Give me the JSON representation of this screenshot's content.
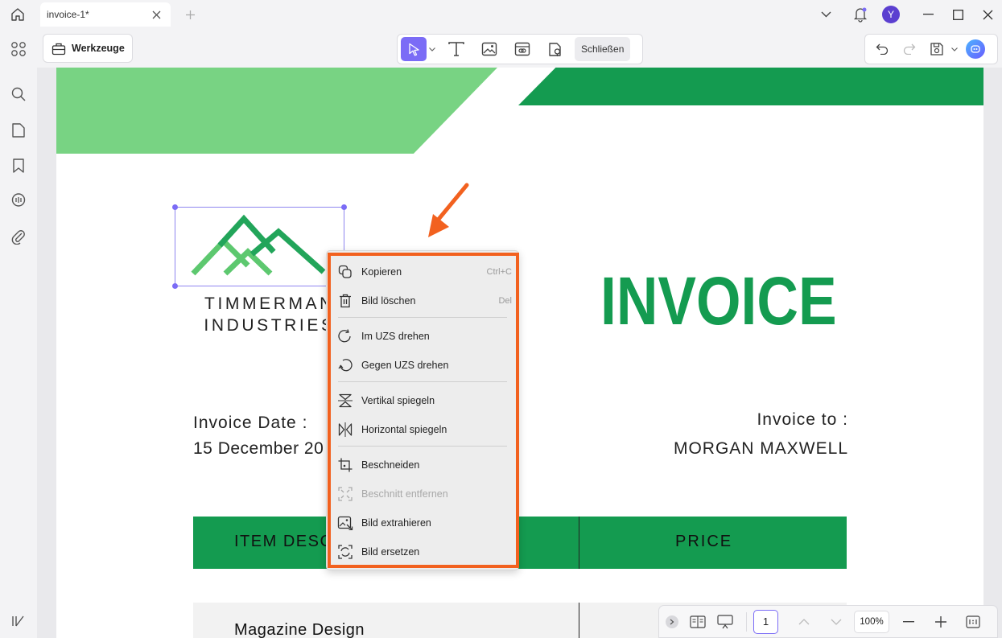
{
  "tab": {
    "title": "invoice-1*"
  },
  "toolbar": {
    "werkzeuge_label": "Werkzeuge",
    "close_label": "Schließen"
  },
  "user": {
    "avatar_letter": "Y"
  },
  "document": {
    "company_line1": "TIMMERMAN",
    "company_line2": "INDUSTRIES",
    "title": "INVOICE",
    "invoice_date_label": "Invoice Date :",
    "invoice_date_value": "15 December 20",
    "invoice_to_label": "Invoice to :",
    "invoice_to_value": "MORGAN MAXWELL",
    "table_header_desc": "ITEM DESC",
    "table_header_price": "PRICE",
    "row1_desc": "Magazine Design",
    "colors": {
      "light_green": "#78d383",
      "dark_green": "#149b50"
    }
  },
  "context_menu": {
    "items": [
      {
        "label": "Kopieren",
        "shortcut": "Ctrl+C",
        "icon": "copy-icon"
      },
      {
        "label": "Bild löschen",
        "shortcut": "Del",
        "icon": "trash-icon"
      },
      {
        "label": "Im UZS drehen",
        "shortcut": "",
        "icon": "rotate-cw-icon"
      },
      {
        "label": "Gegen UZS drehen",
        "shortcut": "",
        "icon": "rotate-ccw-icon"
      },
      {
        "label": "Vertikal spiegeln",
        "shortcut": "",
        "icon": "flip-vertical-icon"
      },
      {
        "label": "Horizontal spiegeln",
        "shortcut": "",
        "icon": "flip-horizontal-icon"
      },
      {
        "label": "Beschneiden",
        "shortcut": "",
        "icon": "crop-icon"
      },
      {
        "label": "Beschnitt entfernen",
        "shortcut": "",
        "icon": "uncrop-icon",
        "disabled": true
      },
      {
        "label": "Bild extrahieren",
        "shortcut": "",
        "icon": "extract-image-icon"
      },
      {
        "label": "Bild ersetzen",
        "shortcut": "",
        "icon": "replace-image-icon"
      }
    ],
    "highlight_color": "#f2611f"
  },
  "pager": {
    "current_page": "1",
    "zoom": "100%"
  }
}
